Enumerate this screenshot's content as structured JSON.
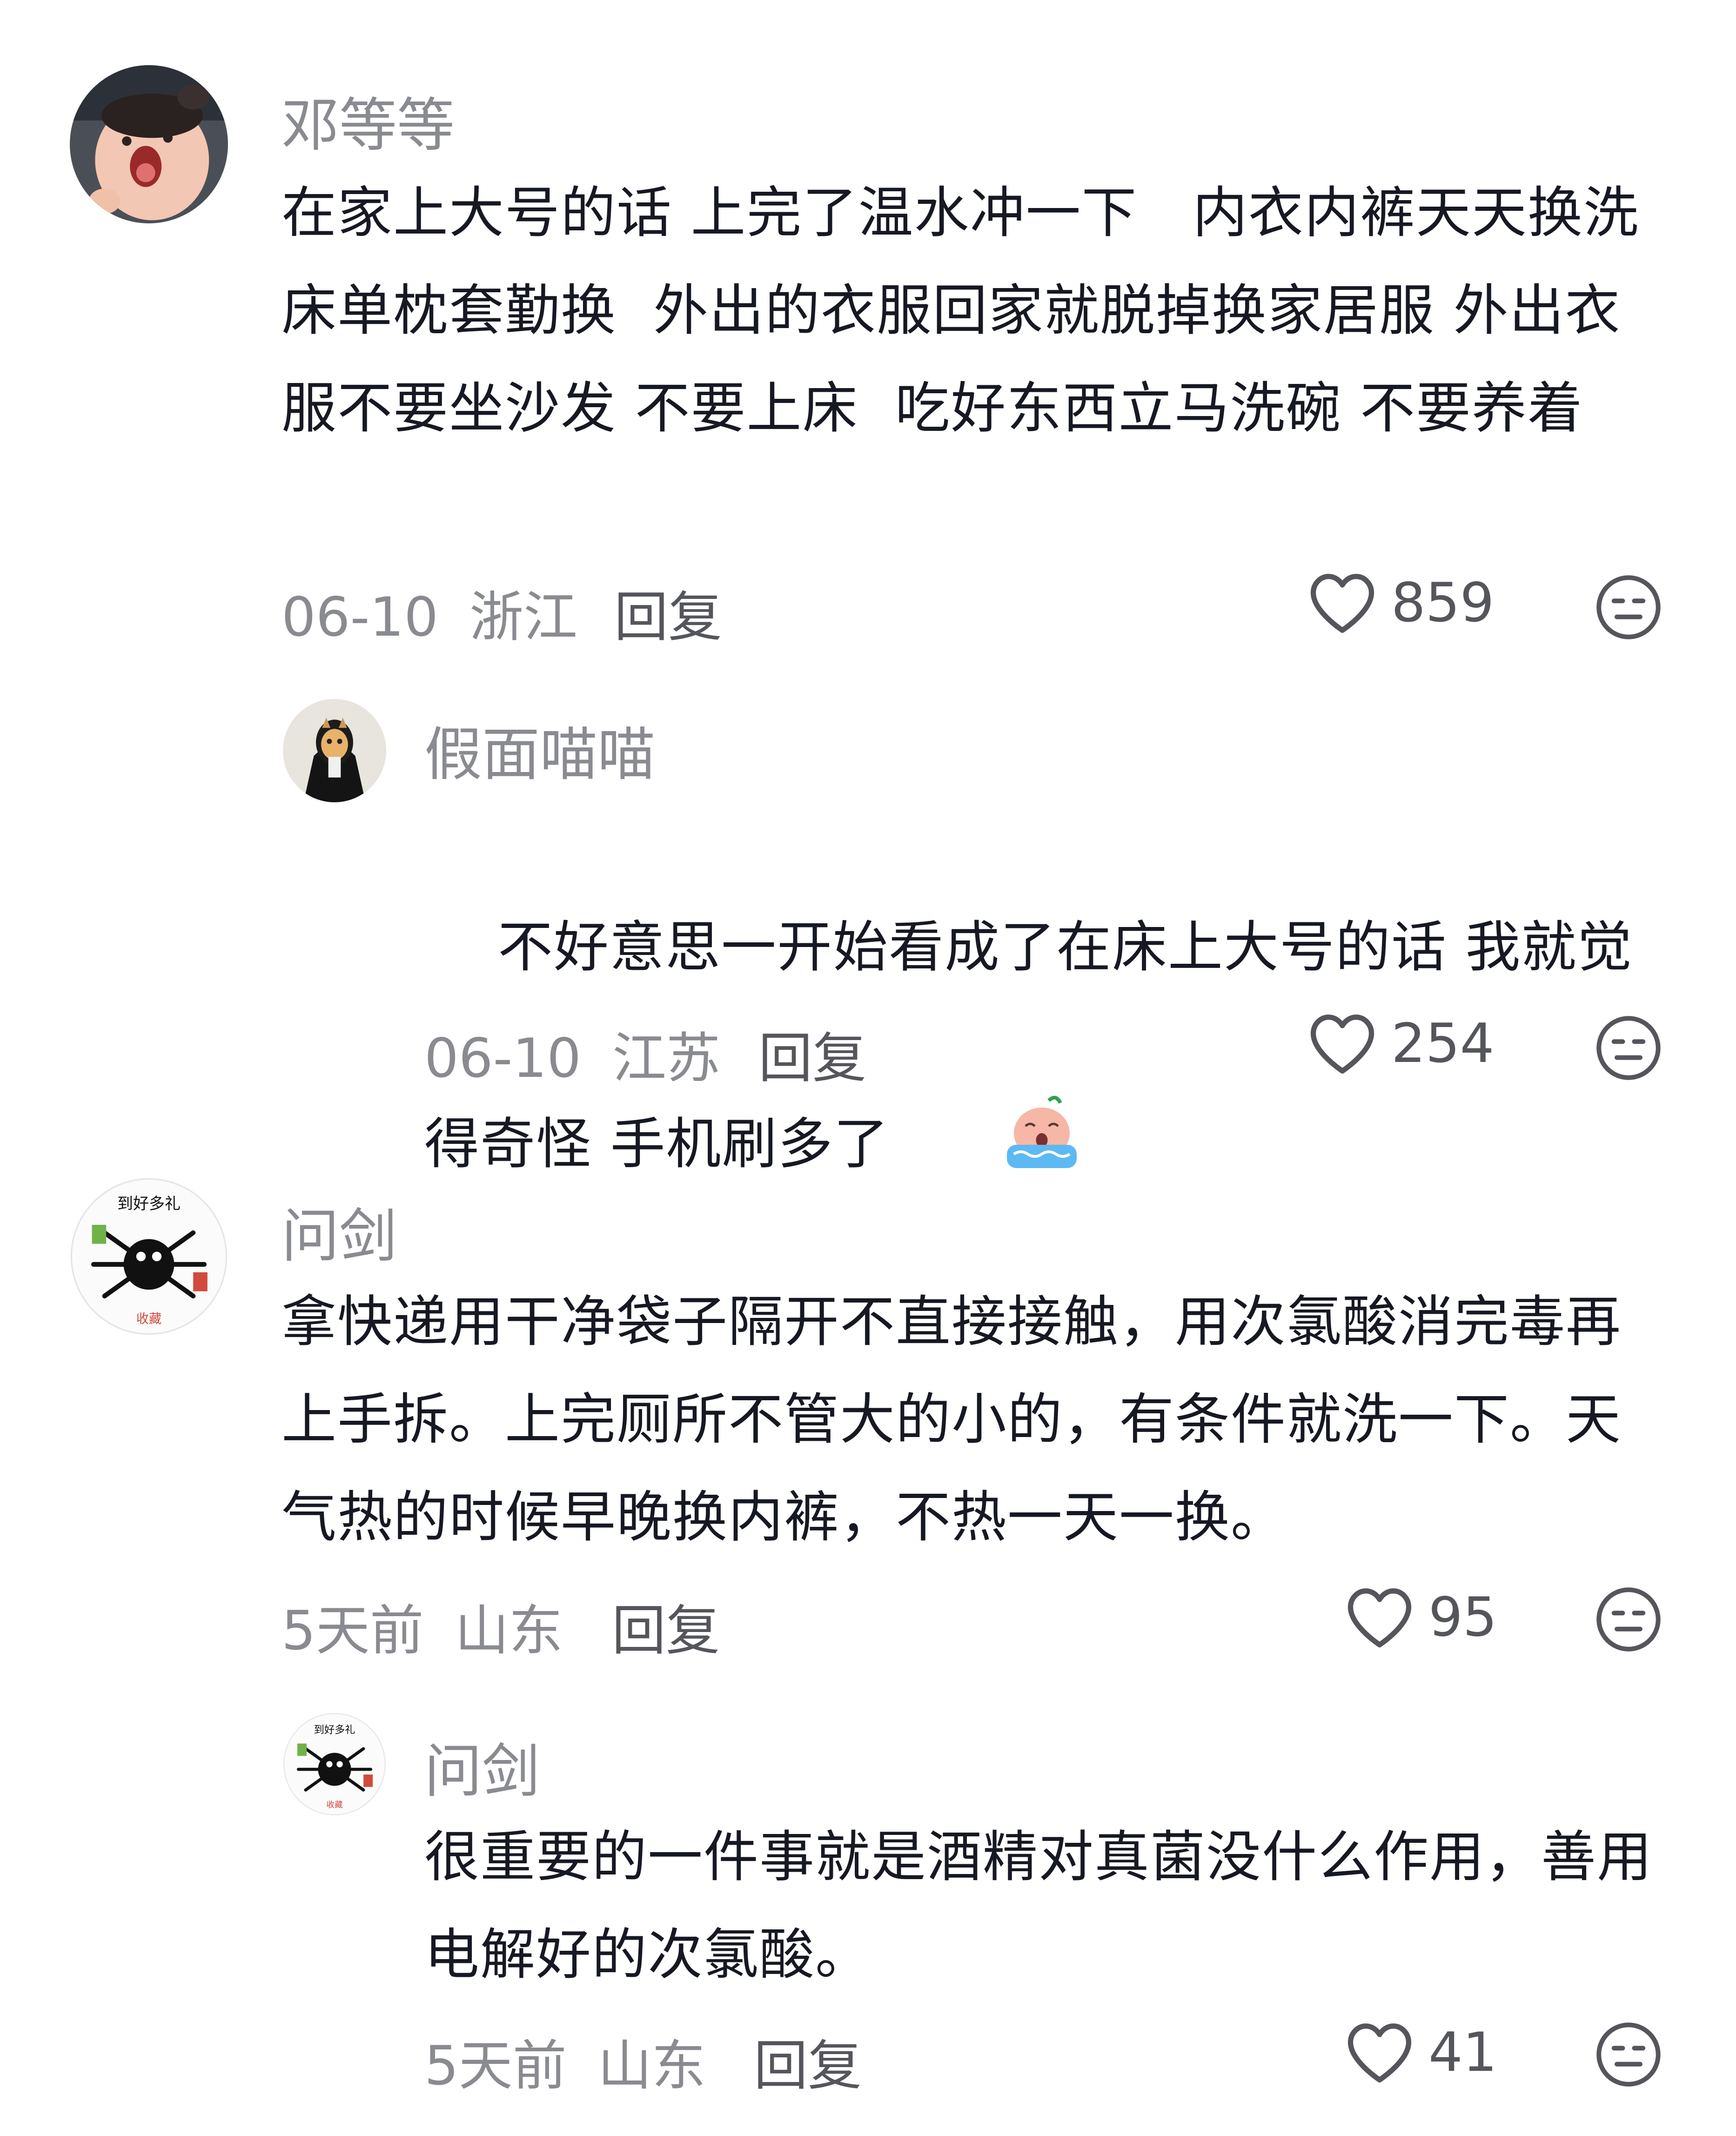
{
  "comments": [
    {
      "username": "邓等等",
      "content": "在家上大号的话 上完了温水冲一下   内衣内裤天天换洗 床单枕套勤换  外出的衣服回家就脱掉换家居服 外出衣服不要坐沙发 不要上床  吃好东西立马洗碗 不要养着",
      "date": "06-10",
      "location": "浙江",
      "reply_label": "回复",
      "likes": "859"
    },
    {
      "username": "假面喵喵",
      "content": "不好意思一开始看成了在床上大号的话 我就觉得奇怪 手机刷多了",
      "date": "06-10",
      "location": "江苏",
      "reply_label": "回复",
      "likes": "254",
      "emoji": "crying-face-emoji"
    },
    {
      "username": "问剑",
      "content": "拿快递用干净袋子隔开不直接接触，用次氯酸消完毒再上手拆。上完厕所不管大的小的，有条件就洗一下。天气热的时候早晚换内裤，不热一天一换。",
      "date": "5天前",
      "location": "山东",
      "reply_label": "回复",
      "likes": "95"
    },
    {
      "username": "问剑",
      "content": "很重要的一件事就是酒精对真菌没什么作用，善用电解好的次氯酸。",
      "date": "5天前",
      "location": "山东",
      "reply_label": "回复",
      "likes": "41"
    }
  ],
  "icons": {
    "like": "heart-outline-icon",
    "dislike": "unhappy-face-icon"
  },
  "colors": {
    "text": "#161823",
    "meta": "#8a8b91",
    "action": "#55565c",
    "background": "#ffffff"
  }
}
